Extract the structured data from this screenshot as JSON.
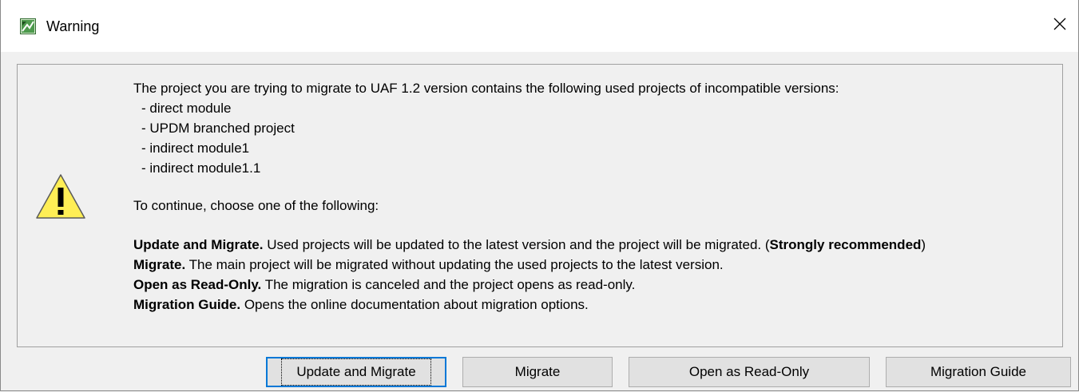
{
  "window": {
    "title": "Warning",
    "close_glyph": "✕"
  },
  "message": {
    "intro": "The project you are trying to migrate to UAF 1.2 version contains the following used projects of incompatible versions:",
    "projects": [
      "- direct module",
      "- UPDM branched project",
      "- indirect module1",
      "- indirect module1.1"
    ],
    "choose": "To continue, choose one of the following:",
    "options": [
      {
        "term": "Update and Migrate.",
        "desc": " Used projects will be updated to the latest version and the project will be migrated. (",
        "emph": "Strongly recommended",
        "tail": ")"
      },
      {
        "term": "Migrate.",
        "desc": " The main project will be migrated without updating the used projects to the latest version."
      },
      {
        "term": "Open as Read-Only.",
        "desc": " The migration is canceled and the project opens as read-only."
      },
      {
        "term": "Migration Guide.",
        "desc": " Opens the online documentation about migration options."
      }
    ]
  },
  "buttons": {
    "update_and_migrate": "Update and Migrate",
    "migrate": "Migrate",
    "open_read_only": "Open as Read-Only",
    "migration_guide": "Migration Guide"
  },
  "colors": {
    "warning_fill": "#ffee55",
    "focus_border": "#0078d7",
    "icon_green": "#3a8a3a"
  },
  "icons": {
    "app": "app-diagram-icon",
    "warning": "warning-triangle-icon",
    "close": "close-icon"
  }
}
